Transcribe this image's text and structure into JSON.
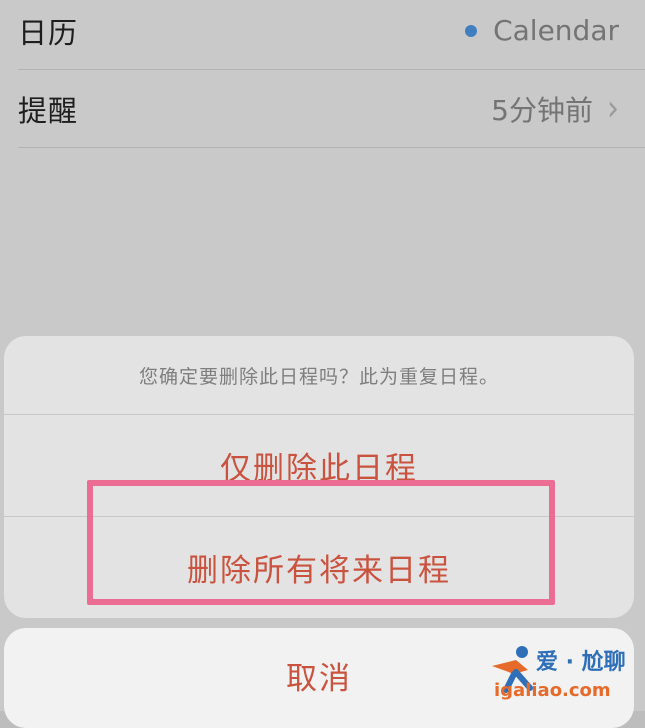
{
  "settings": {
    "rows": [
      {
        "label": "日历",
        "value": "Calendar",
        "dot_color": "#3f7fc0"
      },
      {
        "label": "提醒",
        "value": "5分钟前"
      }
    ]
  },
  "action_sheet": {
    "message": "您确定要删除此日程吗？此为重复日程。",
    "buttons": [
      "仅删除此日程",
      "删除所有将来日程"
    ],
    "cancel": "取消",
    "destructive_color": "#c9533f",
    "highlight_color": "#ec6d94"
  },
  "watermark": {
    "brand": "爱 · 尬聊",
    "url": "igaliao.com"
  }
}
